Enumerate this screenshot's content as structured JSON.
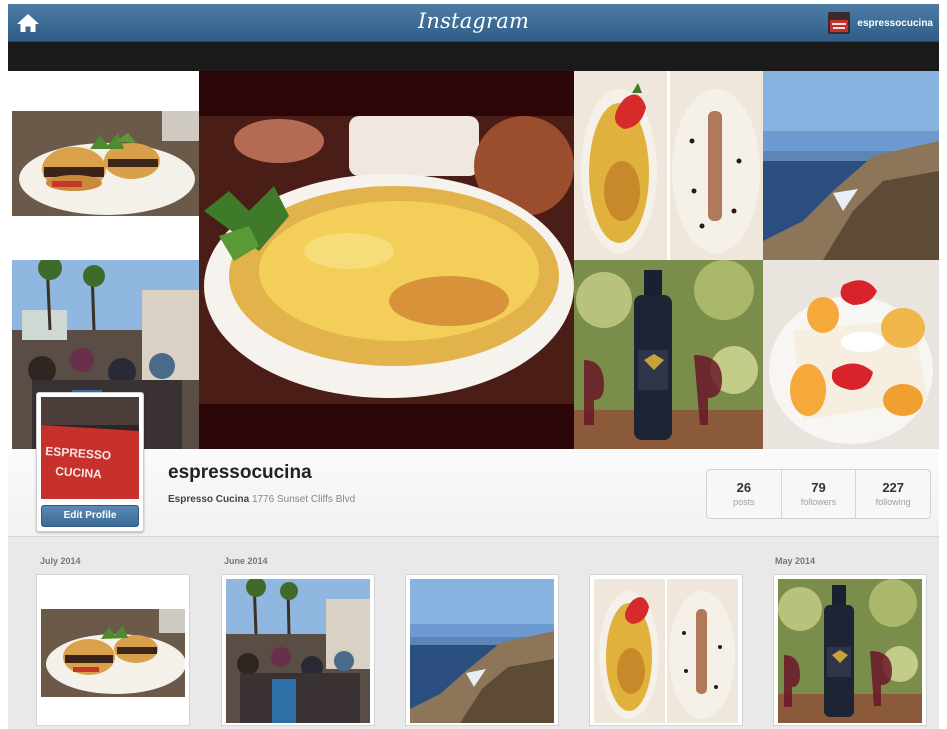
{
  "app": {
    "title": "Instagram"
  },
  "header": {
    "home_icon": "home-icon",
    "logo_text": "Instagram",
    "username": "espressocucina"
  },
  "profile": {
    "username": "espressocucina",
    "full_name": "Espresso Cucina",
    "address": "1776 Sunset Cliffs Blvd",
    "edit_button_label": "Edit Profile",
    "avatar_sign_text": "ESPRESSO CUCINA"
  },
  "stats": [
    {
      "value": "26",
      "label": "posts"
    },
    {
      "value": "79",
      "label": "followers"
    },
    {
      "value": "227",
      "label": "following"
    }
  ],
  "feed": {
    "months": [
      "July 2014",
      "June 2014",
      "May 2014"
    ],
    "photos": [
      {
        "subject": "slider sandwiches on a plate"
      },
      {
        "subject": "crowded street festival"
      },
      {
        "subject": "ocean cliffs"
      },
      {
        "subject": "creme brulee and dessert plates"
      },
      {
        "subject": "wine bottle and glasses"
      }
    ]
  },
  "colors": {
    "header_blue": "#3b6a94",
    "button_blue": "#4a7aa6",
    "background": "#e9e9e9"
  }
}
